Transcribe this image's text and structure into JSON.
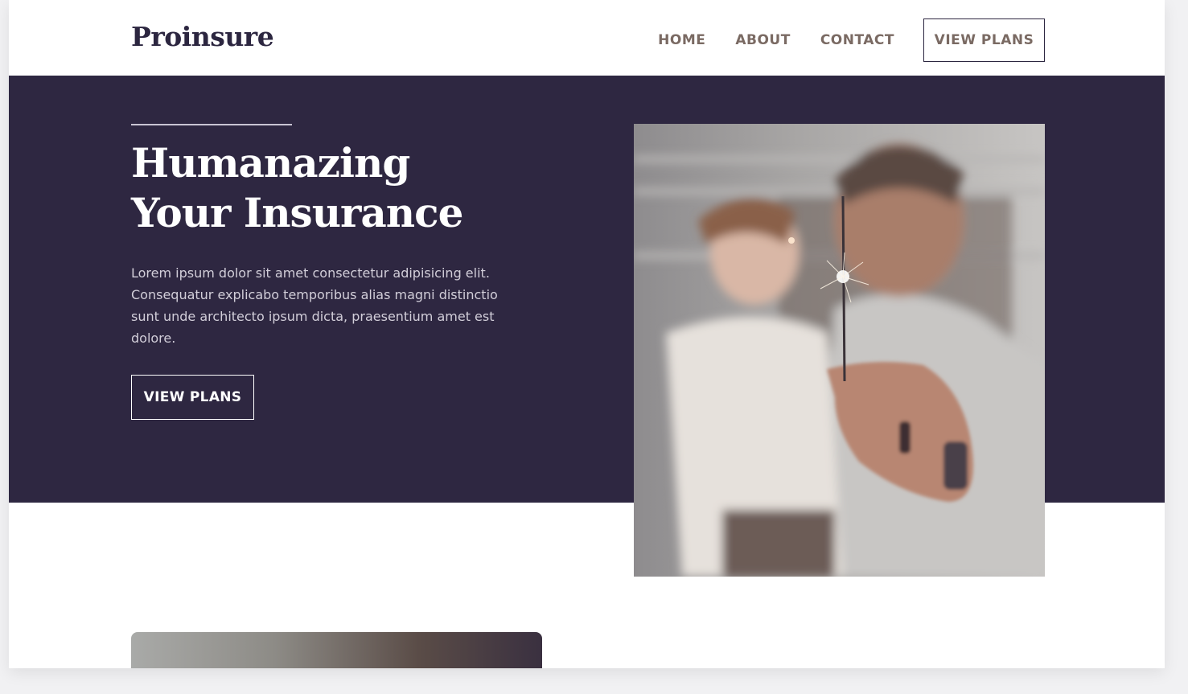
{
  "header": {
    "logo": "Proinsure",
    "nav": [
      {
        "label": "HOME"
      },
      {
        "label": "ABOUT"
      },
      {
        "label": "CONTACT"
      }
    ],
    "cta_label": "VIEW PLANS"
  },
  "hero": {
    "title": "Humanazing Your Insurance",
    "body": "Lorem ipsum dolor sit amet consectetur adipisicing elit. Consequatur explicabo temporibus alias magni distinctio sunt unde architecto ipsum dicta, praesentium amet est dolore.",
    "button_label": "VIEW PLANS"
  },
  "colors": {
    "brand_dark": "#2e2741",
    "nav_text": "#7a6a63",
    "white": "#ffffff"
  }
}
